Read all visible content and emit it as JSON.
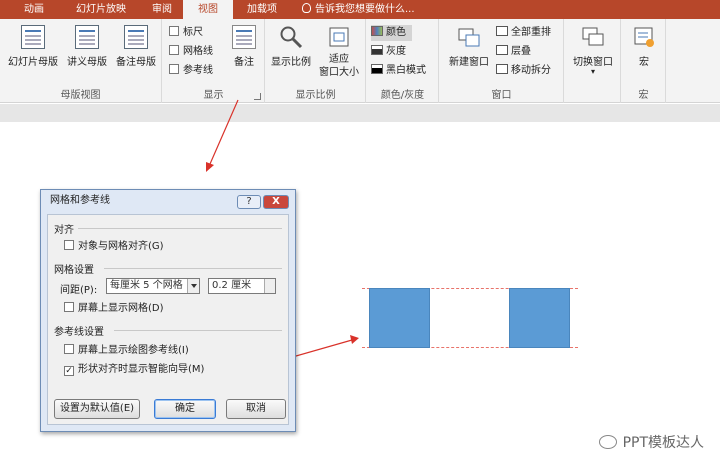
{
  "tabs": [
    "动画",
    "幻灯片放映",
    "审阅",
    "视图",
    "加载项"
  ],
  "active_tab": "视图",
  "tell_me": "告诉我您想要做什么...",
  "ribbon": {
    "master_views": {
      "buttons": [
        "幻灯片母版",
        "讲义母版",
        "备注母版"
      ],
      "label": "母版视图"
    },
    "show": {
      "checks": [
        "标尺",
        "网格线",
        "参考线"
      ],
      "notes": "备注",
      "label": "显示"
    },
    "zoom": {
      "buttons": [
        "显示比例",
        "适应\n窗口大小"
      ],
      "zoom_label": "显示比例",
      "fit_label_1": "适应",
      "fit_label_2": "窗口大小",
      "label": "显示比例"
    },
    "color": {
      "options": [
        "颜色",
        "灰度",
        "黑白模式"
      ],
      "label": "颜色/灰度"
    },
    "window": {
      "new_window": "新建窗口",
      "options": [
        "全部重排",
        "层叠",
        "移动拆分"
      ],
      "label": "窗口"
    },
    "switch": {
      "label": "切换窗口"
    },
    "macro": {
      "button": "宏",
      "label": "宏"
    }
  },
  "dialog": {
    "title": "网格和参考线",
    "help": "?",
    "close": "X",
    "snap_section": "对齐",
    "snap_check": "对象与网格对齐(G)",
    "grid_section": "网格设置",
    "spacing_label": "间距(P):",
    "spacing_select": "每厘米 5 个网格",
    "spacing_value": "0.2 厘米",
    "show_grid": "屏幕上显示网格(D)",
    "guides_section": "参考线设置",
    "show_guides": "屏幕上显示绘图参考线(I)",
    "smart_guides": "形状对齐时显示智能向导(M)",
    "set_default": "设置为默认值(E)",
    "ok": "确定",
    "cancel": "取消"
  },
  "watermark": "PPT模板达人",
  "colors": {
    "tab_bg": "#b7472a",
    "shape": "#5b9bd5",
    "guide": "#e8736a",
    "arrow": "#d9322a"
  }
}
